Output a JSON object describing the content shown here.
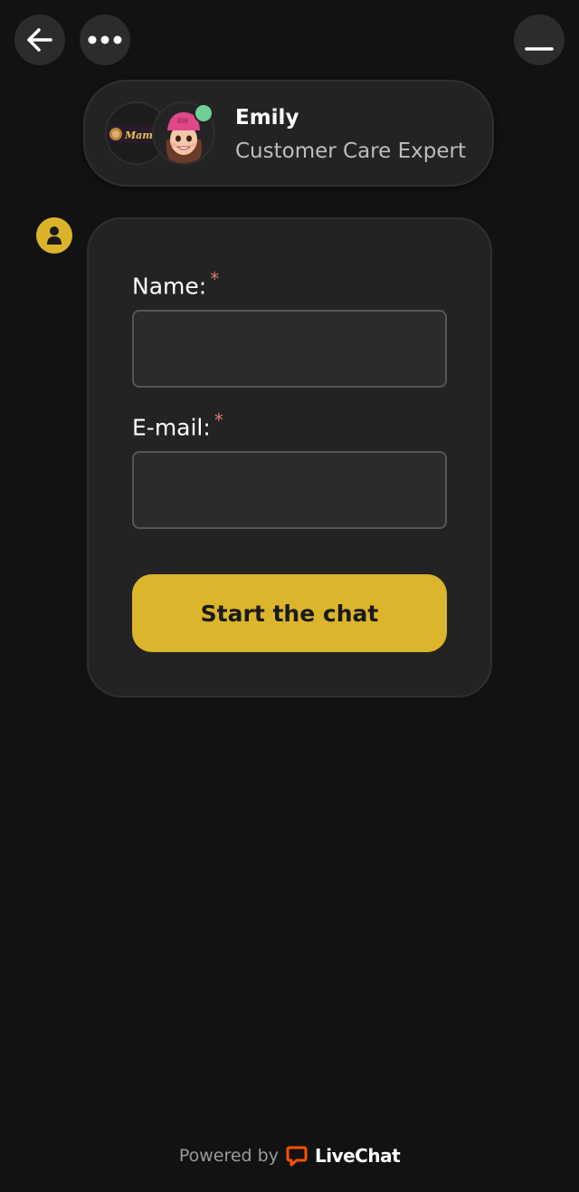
{
  "header": {
    "back_icon": "arrow-left-icon",
    "more_icon": "more-horizontal-icon",
    "minimize_icon": "minimize-icon"
  },
  "agent": {
    "name": "Emily",
    "role": "Customer Care Expert",
    "status": "online",
    "status_color": "#6fcf97",
    "logo_text": "Mama.bet"
  },
  "form": {
    "name_label": "Name:",
    "email_label": "E-mail:",
    "required_mark": "*",
    "name_value": "",
    "email_value": "",
    "submit_label": "Start the chat"
  },
  "footer": {
    "powered_by": "Powered by",
    "brand": "LiveChat"
  },
  "colors": {
    "background": "#121212",
    "card": "#232323",
    "accent": "#dbb52b",
    "required": "#e0776d",
    "brand_orange": "#ff5100"
  }
}
